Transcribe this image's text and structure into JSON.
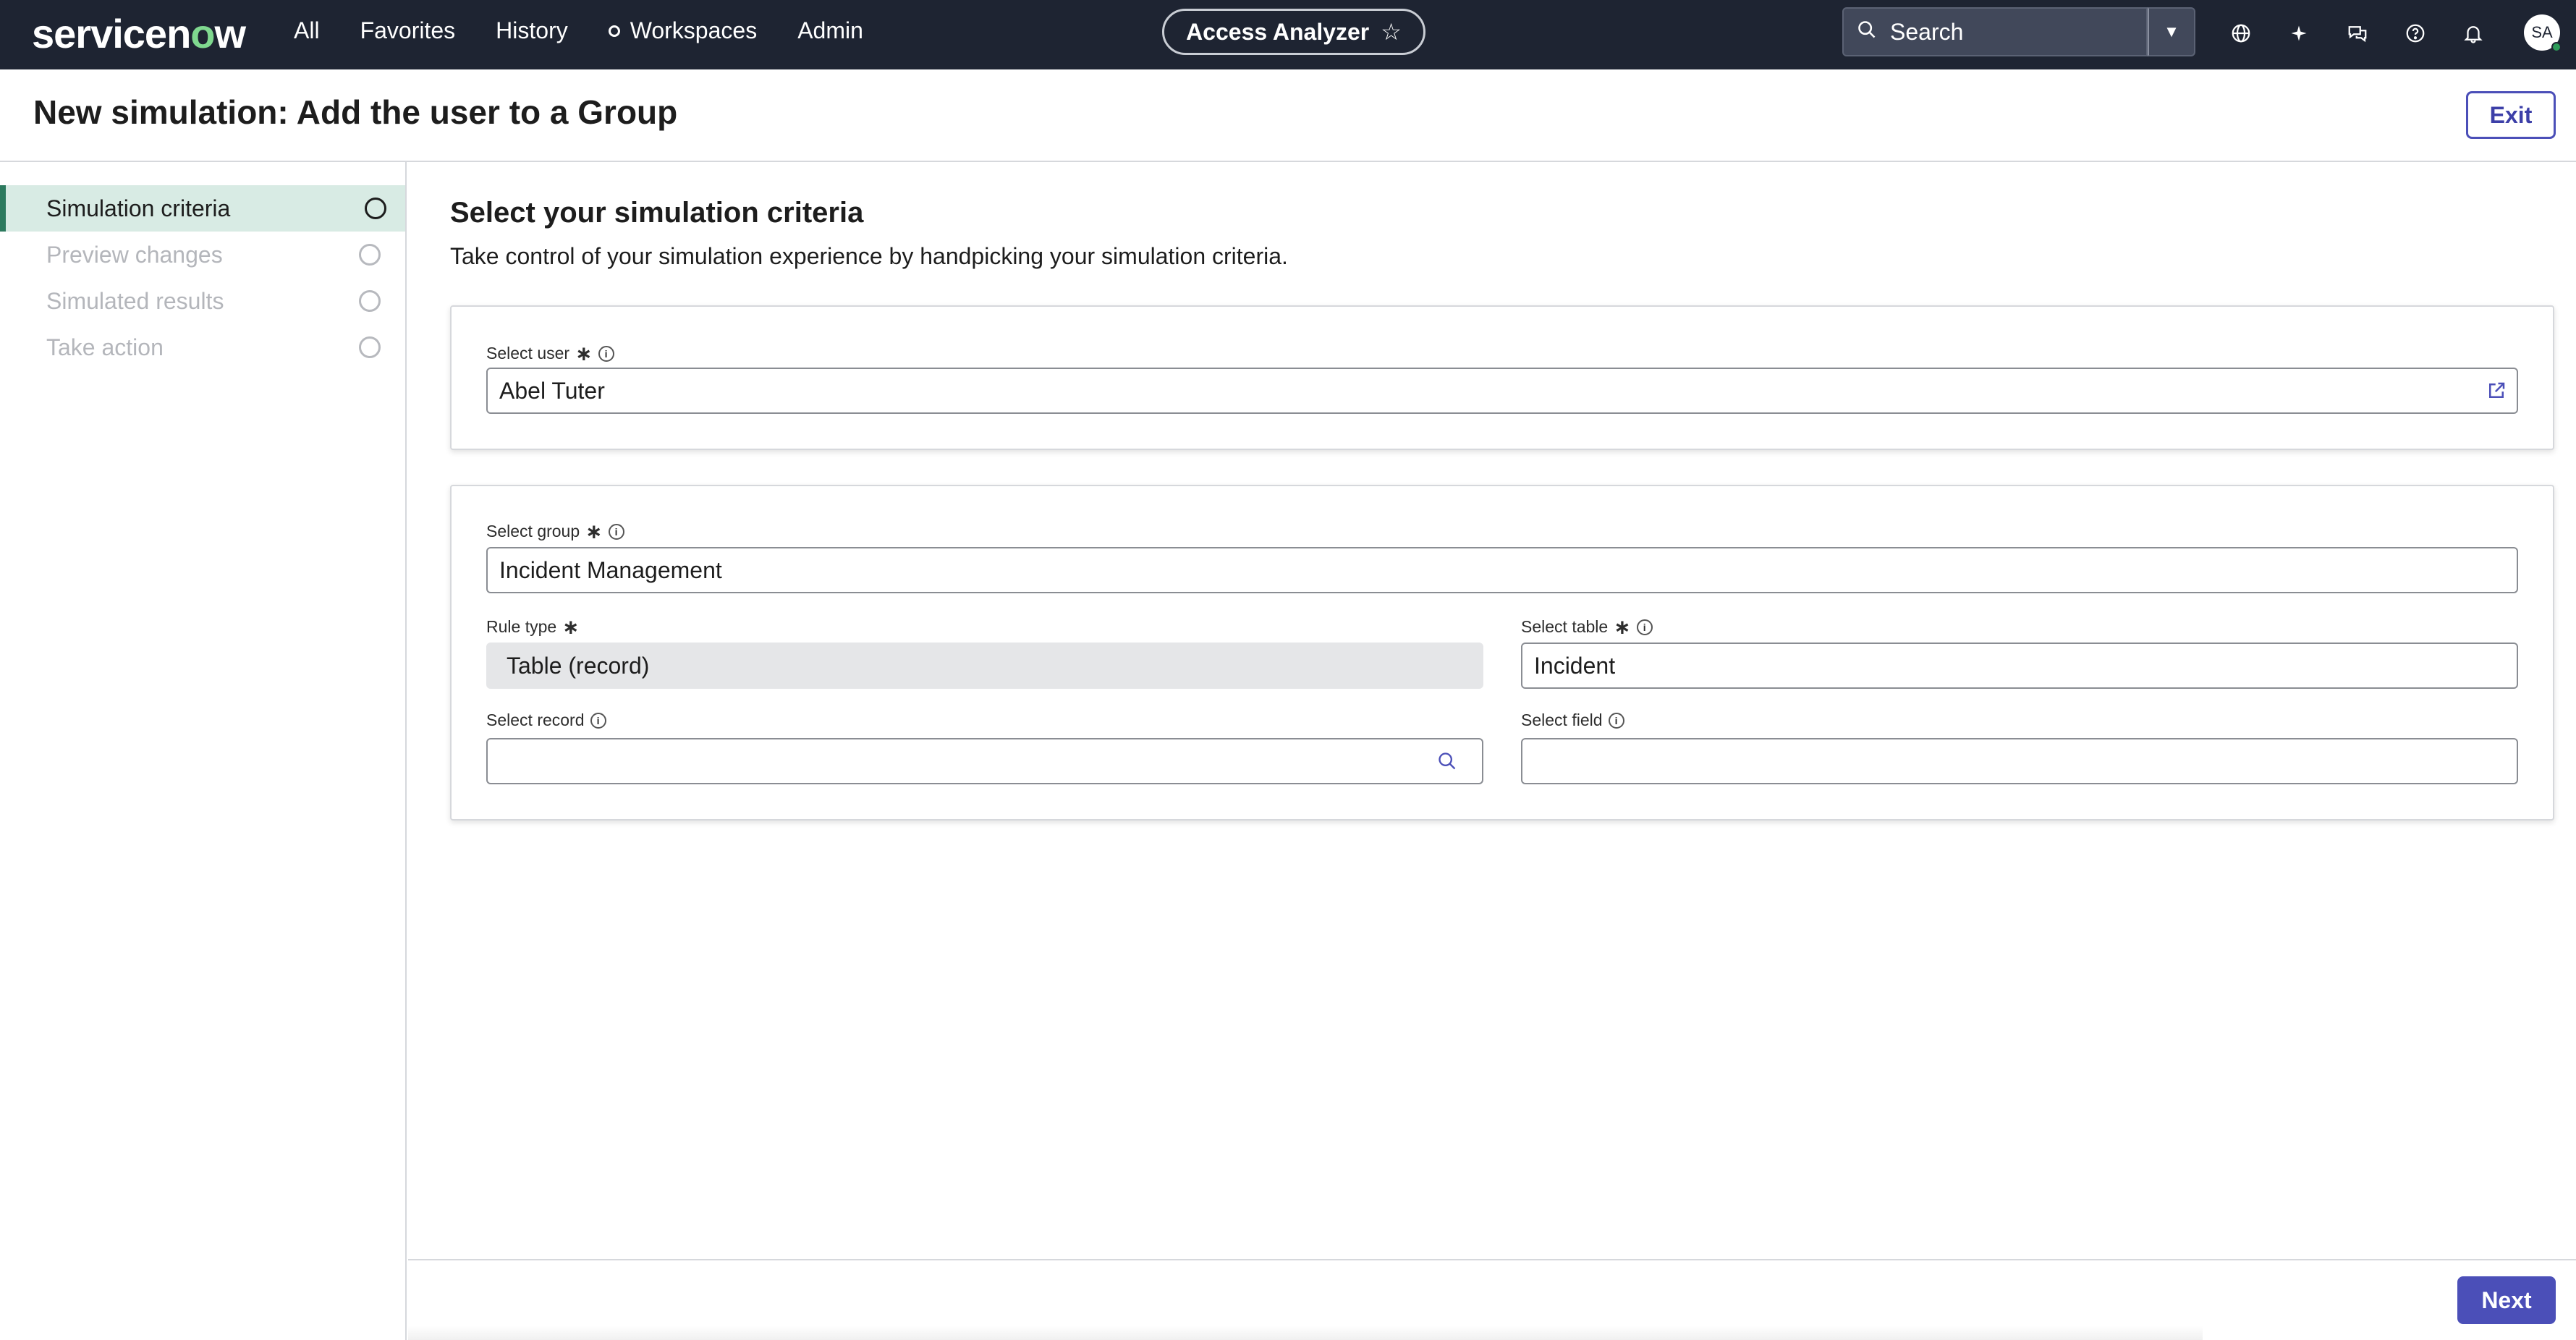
{
  "topnav": {
    "logo_prefix": "servicen",
    "logo_o": "o",
    "logo_suffix": "w",
    "links": [
      "All",
      "Favorites",
      "History",
      "Workspaces",
      "Admin"
    ],
    "app_name": "Access Analyzer",
    "search_placeholder": "Search",
    "avatar_initials": "SA",
    "icons": [
      "globe-icon",
      "sparkle-icon",
      "chat-icon",
      "help-icon",
      "bell-icon"
    ]
  },
  "header": {
    "title": "New simulation: Add the user to a Group",
    "exit_label": "Exit"
  },
  "sidebar": {
    "steps": [
      {
        "label": "Simulation criteria",
        "state": "active"
      },
      {
        "label": "Preview changes",
        "state": "inactive"
      },
      {
        "label": "Simulated results",
        "state": "inactive"
      },
      {
        "label": "Take action",
        "state": "inactive"
      }
    ]
  },
  "main": {
    "title": "Select your simulation criteria",
    "description": "Take control of your simulation experience by handpicking your simulation criteria.",
    "user_card": {
      "user_label": "Select user",
      "user_value": "Abel Tuter"
    },
    "criteria_card": {
      "group_label": "Select group",
      "group_value": "Incident Management",
      "rule_type_label": "Rule type",
      "rule_type_value": "Table (record)",
      "table_label": "Select table",
      "table_value": "Incident",
      "record_label": "Select record",
      "record_value": "",
      "field_label": "Select field",
      "field_value": ""
    }
  },
  "footer": {
    "next_label": "Next"
  },
  "colors": {
    "nav_bg": "#1e2432",
    "accent": "#4b4fb8",
    "active_step_bg": "#d8ebe4",
    "active_step_bar": "#2c7a5e"
  }
}
